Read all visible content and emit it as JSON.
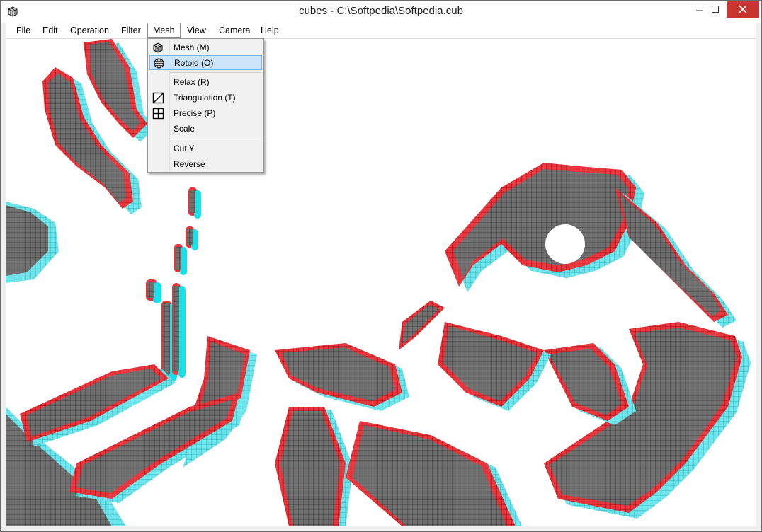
{
  "window": {
    "title": "cubes - C:\\Softpedia\\Softpedia.cub"
  },
  "menubar": [
    {
      "label": "File"
    },
    {
      "label": "Edit"
    },
    {
      "label": "Operation"
    },
    {
      "label": "Filter"
    },
    {
      "label": "Mesh"
    },
    {
      "label": "View"
    },
    {
      "label": "Camera"
    },
    {
      "label": "Help"
    }
  ],
  "mesh_menu": {
    "items": [
      {
        "label": "Mesh (M)",
        "icon": "mesh-cube-icon"
      },
      {
        "label": "Rotoid (O)",
        "icon": "rotoid-sphere-icon",
        "highlighted": true
      },
      {
        "label": "Relax (R)"
      },
      {
        "label": "Triangulation (T)",
        "icon": "triangulation-icon"
      },
      {
        "label": "Precise (P)",
        "icon": "precise-grid-icon"
      },
      {
        "label": "Scale"
      },
      {
        "label": "Cut Y"
      },
      {
        "label": "Reverse"
      }
    ]
  },
  "colors": {
    "anaglyph_red": "#e8343b",
    "anaglyph_cyan": "#16e0e8",
    "face": "#6a6a6a",
    "close": "#c7372f"
  }
}
